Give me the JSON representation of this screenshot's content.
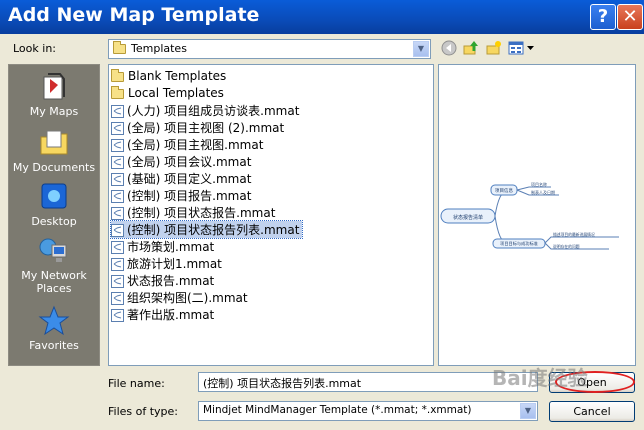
{
  "window": {
    "title": "Add New Map Template",
    "help_glyph": "?",
    "close_glyph": "✕"
  },
  "lookin": {
    "label": "Look in:",
    "value": "Templates"
  },
  "toolbar": {
    "back_icon": "back-icon",
    "up_icon": "up-folder-icon",
    "new_folder_icon": "new-folder-icon",
    "views_icon": "views-menu-icon"
  },
  "places": [
    {
      "label": "My Maps",
      "icon": "my-maps-icon"
    },
    {
      "label": "My Documents",
      "icon": "my-documents-icon"
    },
    {
      "label": "Desktop",
      "icon": "desktop-icon"
    },
    {
      "label": "My Network Places",
      "icon": "network-places-icon"
    },
    {
      "label": "Favorites",
      "icon": "favorites-icon"
    }
  ],
  "files": [
    {
      "name": "Blank Templates",
      "type": "folder"
    },
    {
      "name": "Local Templates",
      "type": "folder"
    },
    {
      "name": "(人力) 项目组成员访谈表.mmat",
      "type": "mmat"
    },
    {
      "name": "(全局) 项目主视图 (2).mmat",
      "type": "mmat"
    },
    {
      "name": "(全局) 项目主视图.mmat",
      "type": "mmat"
    },
    {
      "name": "(全局) 项目会议.mmat",
      "type": "mmat"
    },
    {
      "name": "(基础) 项目定义.mmat",
      "type": "mmat"
    },
    {
      "name": "(控制) 项目报告.mmat",
      "type": "mmat"
    },
    {
      "name": "(控制) 项目状态报告.mmat",
      "type": "mmat"
    },
    {
      "name": "(控制) 项目状态报告列表.mmat",
      "type": "mmat",
      "selected": true
    },
    {
      "name": "市场策划.mmat",
      "type": "mmat"
    },
    {
      "name": "旅游计划1.mmat",
      "type": "mmat"
    },
    {
      "name": "状态报告.mmat",
      "type": "mmat"
    },
    {
      "name": "组织架构图(二).mmat",
      "type": "mmat"
    },
    {
      "name": "著作出版.mmat",
      "type": "mmat"
    }
  ],
  "filename": {
    "label": "File name:",
    "value": "(控制) 项目状态报告列表.mmat"
  },
  "filetype": {
    "label": "Files of type:",
    "value": "Mindjet MindManager Template (*.mmat; *.xmmat)"
  },
  "buttons": {
    "open": "Open",
    "cancel": "Cancel"
  },
  "preview": {
    "central": "状态报告清单",
    "branch1": "项目信息",
    "branch2": "项目目标与成功标准",
    "sub1": "项目名称",
    "sub2": "制表人及日期",
    "sub3": "描述项目的最新进展情况",
    "sub4": "说明存在的问题"
  },
  "watermark": "Bai度经验",
  "colors": {
    "titlebar": "#0a4bb8",
    "selection": "#c1d2ee",
    "places_bg": "#7c7a70",
    "highlight_ring": "#e02020"
  }
}
